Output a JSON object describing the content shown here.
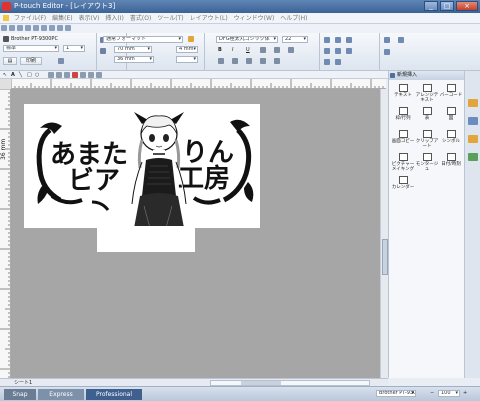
{
  "window": {
    "title": "P-touch Editor - [レイアウト3]",
    "min": "_",
    "max": "□",
    "close": "×"
  },
  "menu": [
    "ファイル(F)",
    "編集(E)",
    "表示(V)",
    "挿入(I)",
    "書式(O)",
    "ツール(T)",
    "レイアウト(L)",
    "ウィンドウ(W)",
    "ヘルプ(H)"
  ],
  "ribbon": {
    "printer": "Brother PT-9300PC",
    "standard": "標準",
    "copies": "1",
    "print_label": "印刷",
    "format": "通常フォーマット",
    "length": "70 mm",
    "margin": "4 mm",
    "tape_width": "36 mm",
    "font": "DFG極太丸ゴシック体",
    "font_size": "22",
    "bold": "B",
    "italic": "I",
    "underline": "U"
  },
  "ruler": {
    "unit_label": "36 mm"
  },
  "label_art": {
    "line1_left": "あまた",
    "line1_right": "りん",
    "line2_left": "ビア",
    "line2_right": "工房"
  },
  "panel": {
    "title": "新規挿入",
    "items": [
      {
        "label": "テキスト",
        "icon": "text-icon"
      },
      {
        "label": "アレンジテキスト",
        "icon": "arrange-text-icon"
      },
      {
        "label": "バーコード",
        "icon": "barcode-icon"
      },
      {
        "label": "枠/行列",
        "icon": "frame-icon"
      },
      {
        "label": "表",
        "icon": "table-icon"
      },
      {
        "label": "図",
        "icon": "image-icon"
      },
      {
        "label": "画面コピー",
        "icon": "screen-copy-icon"
      },
      {
        "label": "クリップアート",
        "icon": "clipart-icon"
      },
      {
        "label": "シンボル",
        "icon": "symbol-icon"
      },
      {
        "label": "ピクチャーメイキング",
        "icon": "picture-making-icon"
      },
      {
        "label": "モンタージュ",
        "icon": "montage-icon"
      },
      {
        "label": "日付/時刻",
        "icon": "clock-icon"
      },
      {
        "label": "カレンダー",
        "icon": "calendar-icon"
      }
    ]
  },
  "sheet": {
    "tab": "シート1"
  },
  "status": {
    "modes": [
      "Snap",
      "Express",
      "Professional"
    ],
    "printer": "Brother PT-930",
    "zoom": "100"
  }
}
